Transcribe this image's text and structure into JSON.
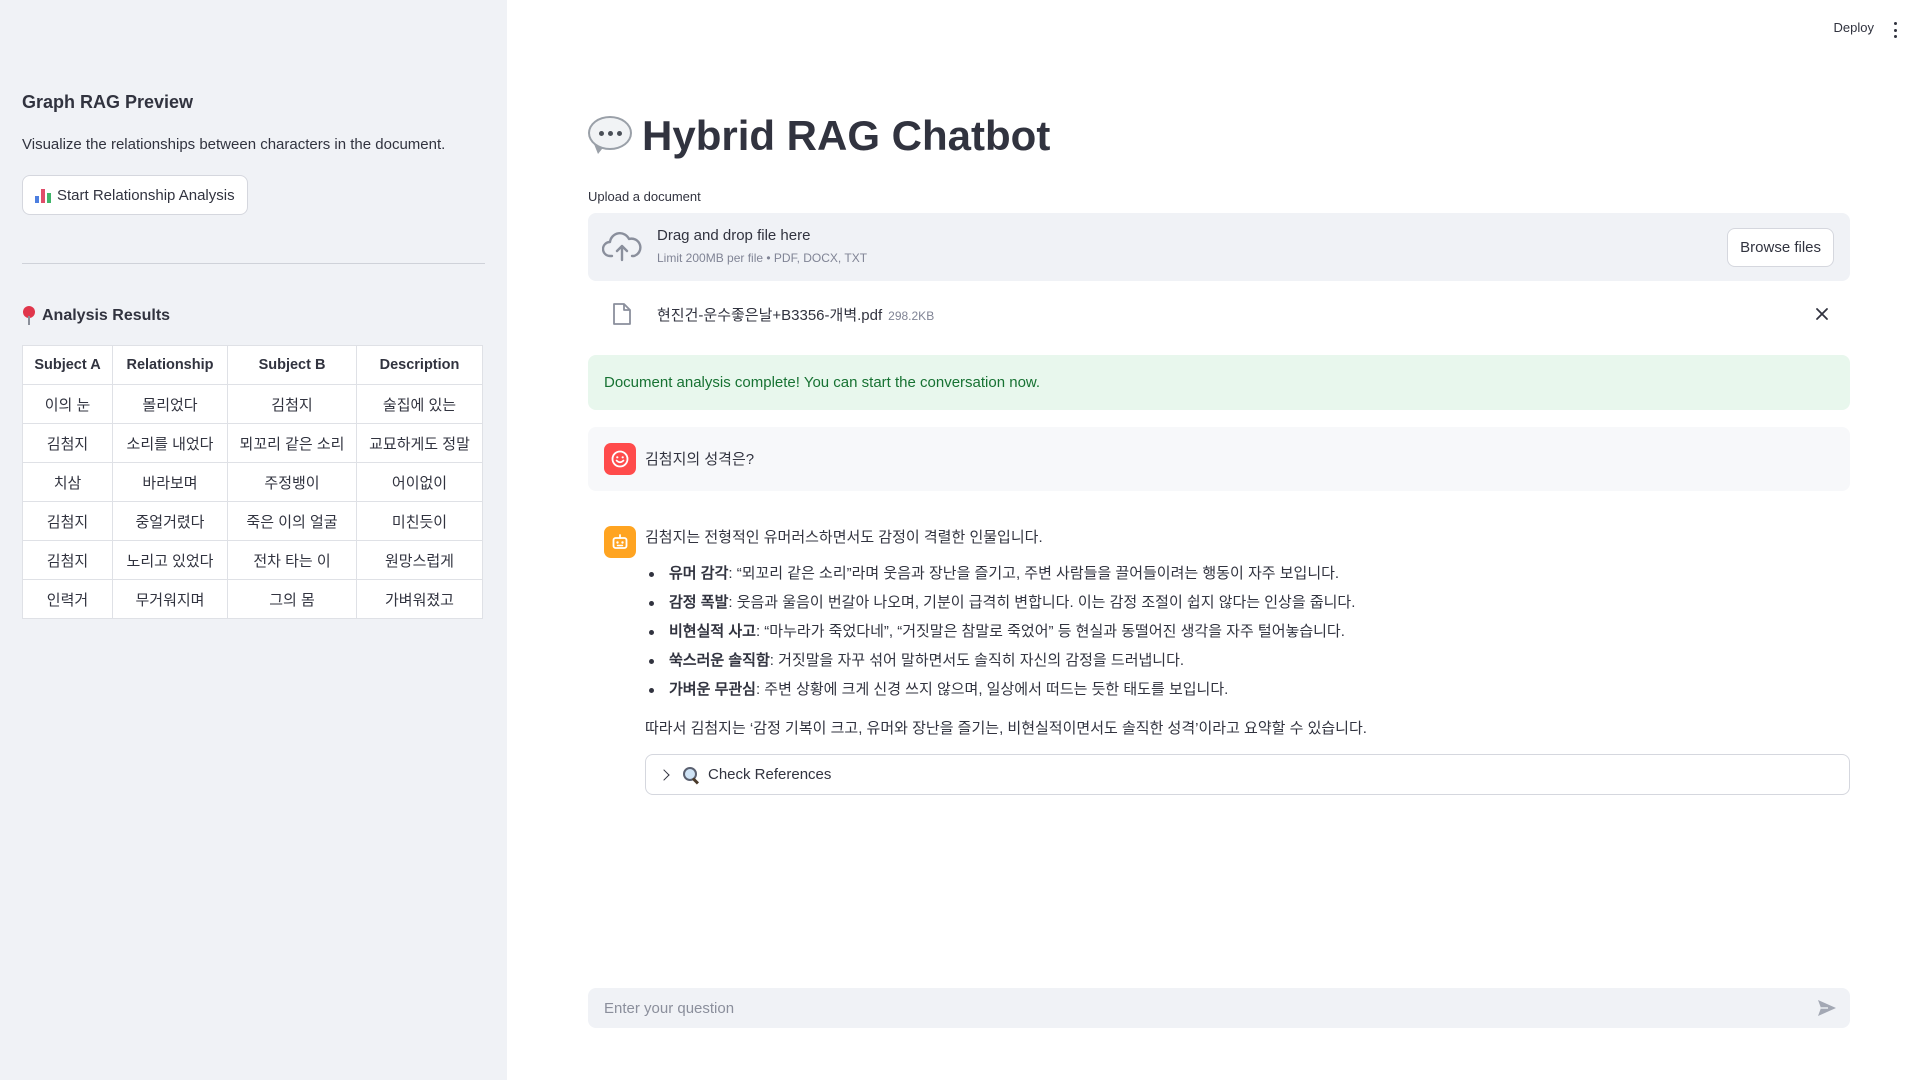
{
  "sidebar": {
    "title": "Graph RAG Preview",
    "description": "Visualize the relationships between characters in the document.",
    "button_label": "Start Relationship Analysis",
    "results_title": "Analysis Results",
    "table": {
      "headers": [
        "Subject A",
        "Relationship",
        "Subject B",
        "Description"
      ],
      "rows": [
        [
          "이의 눈",
          "몰리었다",
          "김첨지",
          "술집에 있는"
        ],
        [
          "김첨지",
          "소리를 내었다",
          "뫼꼬리 같은 소리",
          "교묘하게도 정말"
        ],
        [
          "치삼",
          "바라보며",
          "주정뱅이",
          "어이없이"
        ],
        [
          "김첨지",
          "중얼거렸다",
          "죽은 이의 얼굴",
          "미친듯이"
        ],
        [
          "김첨지",
          "노리고 있었다",
          "전차 타는 이",
          "원망스럽게"
        ],
        [
          "인력거",
          "무거워지며",
          "그의 몸",
          "가벼워졌고"
        ]
      ]
    }
  },
  "header": {
    "deploy_label": "Deploy"
  },
  "main": {
    "title": "Hybrid RAG Chatbot",
    "upload_label": "Upload a document",
    "dropzone_main": "Drag and drop file here",
    "dropzone_sub": "Limit 200MB per file • PDF, DOCX, TXT",
    "browse_label": "Browse files",
    "file_name": "현진건-운수좋은날+B3356-개벽.pdf",
    "file_size": "298.2KB",
    "success_message": "Document analysis complete! You can start the conversation now.",
    "user_message": "김첨지의 성격은?",
    "bot_intro": "김첨지는 전형적인 유머러스하면서도 감정이 격렬한 인물입니다.",
    "bot_points": [
      {
        "term": "유머 감각",
        "text": ": “뫼꼬리 같은 소리”라며 웃음과 장난을 즐기고, 주변 사람들을 끌어들이려는 행동이 자주 보입니다."
      },
      {
        "term": "감정 폭발",
        "text": ": 웃음과 울음이 번갈아 나오며, 기분이 급격히 변합니다. 이는 감정 조절이 쉽지 않다는 인상을 줍니다."
      },
      {
        "term": "비현실적 사고",
        "text": ": “마누라가 죽었다네”, “거짓말은 참말로 죽었어” 등 현실과 동떨어진 생각을 자주 털어놓습니다."
      },
      {
        "term": "쑥스러운 솔직함",
        "text": ": 거짓말을 자꾸 섞어 말하면서도 솔직히 자신의 감정을 드러냅니다."
      },
      {
        "term": "가벼운 무관심",
        "text": ": 주변 상황에 크게 신경 쓰지 않으며, 일상에서 떠드는 듯한 태도를 보입니다."
      }
    ],
    "bot_summary": "따라서 김첨지는 ‘감정 기복이 크고, 유머와 장난을 즐기는, 비현실적이면서도 솔직한 성격’이라고 요약할 수 있습니다.",
    "expander_label": "Check References",
    "chat_placeholder": "Enter your question"
  },
  "colors": {
    "sidebar_bg": "#f0f2f6",
    "success_bg": "#e8f7ed",
    "success_text": "#177233",
    "user_avatar": "#ff4b4b",
    "bot_avatar": "#ffa421"
  },
  "icons": {
    "button": "bar-chart-icon",
    "results": "pin-icon",
    "title": "speech-bubble-icon",
    "dropzone": "cloud-upload-icon",
    "file": "file-icon",
    "remove": "close-icon",
    "expander": "magnifier-icon",
    "send": "send-icon"
  }
}
